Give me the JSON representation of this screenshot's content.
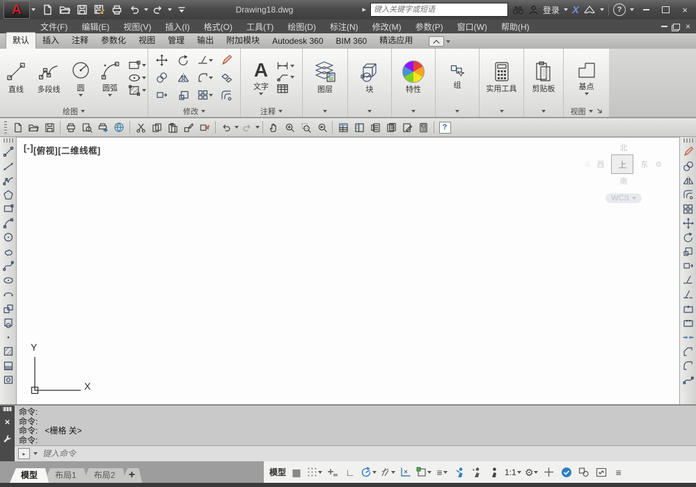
{
  "window": {
    "title": "Drawing18.dwg"
  },
  "titlebar": {
    "search_placeholder": "键入关键字或短语",
    "signin_label": "登录"
  },
  "menubar": {
    "items": [
      "文件(F)",
      "编辑(E)",
      "视图(V)",
      "插入(I)",
      "格式(O)",
      "工具(T)",
      "绘图(D)",
      "标注(N)",
      "修改(M)",
      "参数(P)",
      "窗口(W)",
      "帮助(H)"
    ]
  },
  "ribbon": {
    "tabs": [
      "默认",
      "插入",
      "注释",
      "参数化",
      "视图",
      "管理",
      "输出",
      "附加模块",
      "Autodesk 360",
      "BIM 360",
      "精选应用"
    ],
    "active_tab": "默认",
    "draw_panel": {
      "label": "绘图",
      "line": "直线",
      "polyline": "多段线",
      "circle": "圆",
      "arc": "圆弧"
    },
    "modify_panel": {
      "label": "修改"
    },
    "annotation_panel": {
      "label": "注释",
      "text": "文字"
    },
    "layers_panel": {
      "label": "图层"
    },
    "block_panel": {
      "label": "块"
    },
    "properties_panel": {
      "label": "特性"
    },
    "group_panel": {
      "label": "组"
    },
    "utilities_panel": {
      "label": "实用工具"
    },
    "clipboard_panel": {
      "label": "剪贴板"
    },
    "view_panel": {
      "label": "视图",
      "base": "基点"
    }
  },
  "viewport": {
    "controls": "[-]",
    "view_name": "[俯视]",
    "visual_style": "[二维线框]"
  },
  "viewcube": {
    "north": "北",
    "west": "西",
    "top": "上",
    "east": "东",
    "south": "南",
    "wcs_label": "WCS"
  },
  "ucs": {
    "x_label": "X",
    "y_label": "Y"
  },
  "command": {
    "history": [
      "命令:",
      "命令:",
      "命令:   <栅格 关>",
      "命令:"
    ],
    "input_placeholder": "键入命令"
  },
  "layout_tabs": {
    "model": "模型",
    "layout1": "布局1",
    "layout2": "布局2"
  },
  "statusbar": {
    "model_label": "模型",
    "scale": "1:1"
  },
  "icons": {
    "logo_glyph": "A",
    "exchange_glyph": "X",
    "help_glyph": "?",
    "close_glyph": "×",
    "home_glyph": "⌂",
    "gear_glyph": "⚙",
    "grid_glyph": "▦",
    "ortho_glyph": "∟",
    "lineweight_glyph": "≡",
    "menu_glyph": "≡",
    "plus_glyph": "+",
    "prompt_glyph": "▸",
    "expand_glyph": "▸"
  }
}
